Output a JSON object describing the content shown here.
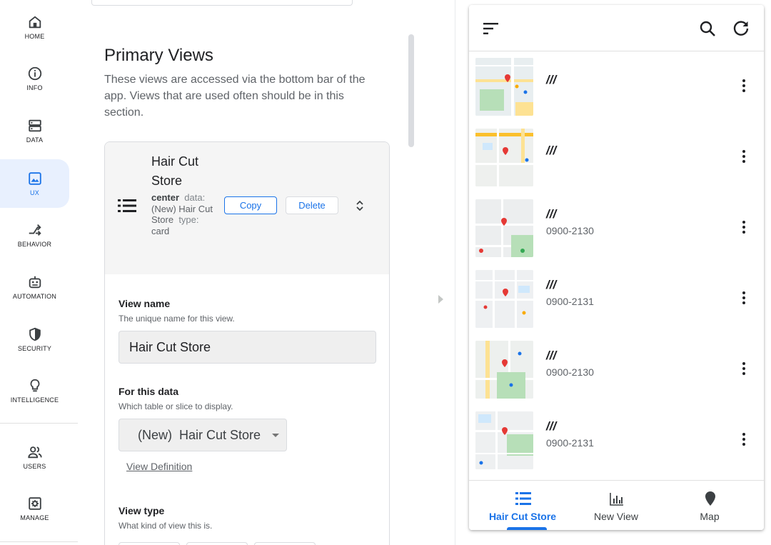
{
  "nav": {
    "items": [
      {
        "label": "HOME",
        "icon": "home-icon"
      },
      {
        "label": "INFO",
        "icon": "info-icon"
      },
      {
        "label": "DATA",
        "icon": "data-icon"
      },
      {
        "label": "UX",
        "icon": "image-icon",
        "active": true
      },
      {
        "label": "BEHAVIOR",
        "icon": "behavior-icon"
      },
      {
        "label": "AUTOMATION",
        "icon": "robot-icon"
      },
      {
        "label": "SECURITY",
        "icon": "shield-icon"
      },
      {
        "label": "INTELLIGENCE",
        "icon": "lightbulb-icon"
      },
      {
        "label": "USERS",
        "icon": "users-icon"
      },
      {
        "label": "MANAGE",
        "icon": "gear-icon"
      }
    ]
  },
  "editor": {
    "section_title": "Primary Views",
    "section_desc": "These views are accessed via the bottom bar of the app. Views that are used often should be in this section.",
    "view": {
      "title": "Hair Cut Store",
      "position": "center",
      "data_key": "data:",
      "data_value": "(New) Hair Cut Store",
      "type_key": "type:",
      "type_value": "card",
      "copy_label": "Copy",
      "delete_label": "Delete"
    },
    "view_name": {
      "label": "View name",
      "help": "The unique name for this view.",
      "value": "Hair Cut Store"
    },
    "for_this_data": {
      "label": "For this data",
      "help": "Which table or slice to display.",
      "value": "(New)  Hair Cut Store",
      "link": "View Definition"
    },
    "view_type": {
      "label": "View type",
      "help": "What kind of view this is."
    }
  },
  "preview": {
    "rows": [
      {
        "title": "///",
        "subtitle": ""
      },
      {
        "title": "///",
        "subtitle": ""
      },
      {
        "title": "///",
        "subtitle": "0900-2130"
      },
      {
        "title": "///",
        "subtitle": "0900-2131"
      },
      {
        "title": "///",
        "subtitle": "0900-2130"
      },
      {
        "title": "///",
        "subtitle": "0900-2131"
      }
    ],
    "tabs": [
      {
        "label": "Hair Cut Store",
        "icon": "list-icon",
        "active": true
      },
      {
        "label": "New View",
        "icon": "chart-icon"
      },
      {
        "label": "Map",
        "icon": "map-pin-icon"
      }
    ]
  },
  "colors": {
    "accent": "#1a73e8",
    "active_nav_bg": "#e8f0fe",
    "map_pin": "#e53935"
  }
}
